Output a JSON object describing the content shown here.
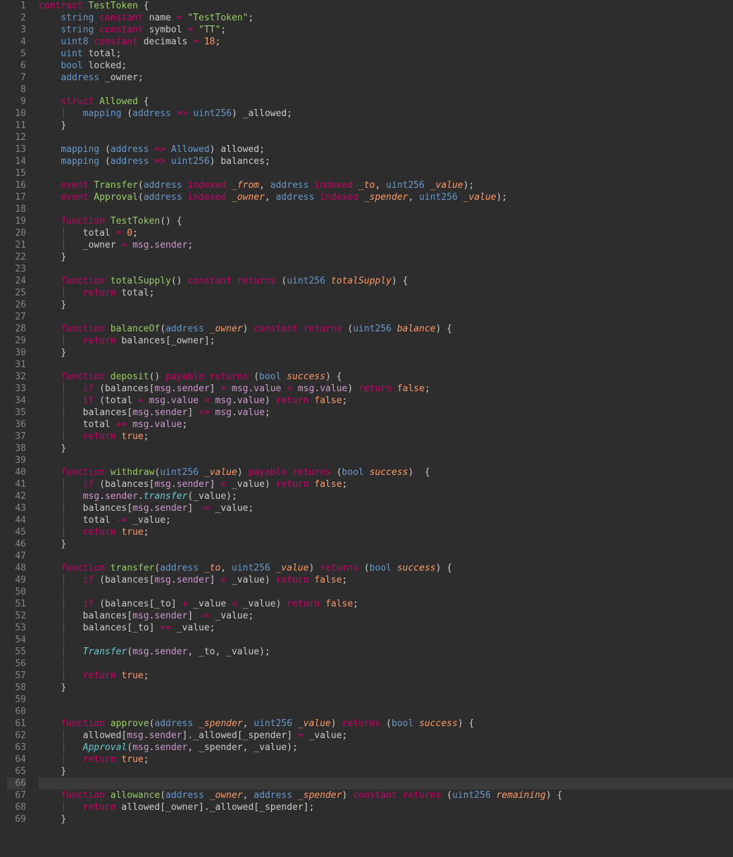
{
  "editor": {
    "active_line": 66,
    "lines": [
      {
        "n": 1,
        "html": "<span class='kw'>contract</span> <span class='fname'>TestToken</span> <span class='punct'>{</span>"
      },
      {
        "n": 2,
        "html": "    <span class='type'>string</span> <span class='mod'>constant</span> <span class='ident'>name</span> <span class='op'>=</span> <span class='str'>\"TestToken\"</span><span class='punct'>;</span>"
      },
      {
        "n": 3,
        "html": "    <span class='type'>string</span> <span class='mod'>constant</span> <span class='ident'>symbol</span> <span class='op'>=</span> <span class='str'>\"TT\"</span><span class='punct'>;</span>"
      },
      {
        "n": 4,
        "html": "    <span class='type'>uint8</span> <span class='mod'>constant</span> <span class='ident'>decimals</span> <span class='op'>=</span> <span class='num'>18</span><span class='punct'>;</span>"
      },
      {
        "n": 5,
        "html": "    <span class='type'>uint</span> <span class='ident'>total</span><span class='punct'>;</span>"
      },
      {
        "n": 6,
        "html": "    <span class='type'>bool</span> <span class='ident'>locked</span><span class='punct'>;</span>"
      },
      {
        "n": 7,
        "html": "    <span class='type'>address</span> <span class='ident'>_owner</span><span class='punct'>;</span>"
      },
      {
        "n": 8,
        "html": ""
      },
      {
        "n": 9,
        "html": "    <span class='kw'>struct</span> <span class='fname'>Allowed</span> <span class='punct'>{</span>"
      },
      {
        "n": 10,
        "html": "    <span class='guide'>│</span>   <span class='type'>mapping</span> <span class='punct'>(</span><span class='type'>address</span> <span class='op'>=&gt;</span> <span class='type'>uint256</span><span class='punct'>)</span> <span class='ident'>_allowed</span><span class='punct'>;</span>"
      },
      {
        "n": 11,
        "html": "    <span class='punct'>}</span>"
      },
      {
        "n": 12,
        "html": ""
      },
      {
        "n": 13,
        "html": "    <span class='type'>mapping</span> <span class='punct'>(</span><span class='type'>address</span> <span class='op'>=&gt;</span> <span class='type'>Allowed</span><span class='punct'>)</span> <span class='ident'>allowed</span><span class='punct'>;</span>"
      },
      {
        "n": 14,
        "html": "    <span class='type'>mapping</span> <span class='punct'>(</span><span class='type'>address</span> <span class='op'>=&gt;</span> <span class='type'>uint256</span><span class='punct'>)</span> <span class='ident'>balances</span><span class='punct'>;</span>"
      },
      {
        "n": 15,
        "html": ""
      },
      {
        "n": 16,
        "html": "    <span class='kw'>event</span> <span class='fname'>Transfer</span><span class='punct'>(</span><span class='type'>address</span> <span class='mod'>indexed</span> <span class='param'>_from</span><span class='punct'>,</span> <span class='type'>address</span> <span class='mod'>indexed</span> <span class='param'>_to</span><span class='punct'>,</span> <span class='type'>uint256</span> <span class='param'>_value</span><span class='punct'>);</span>"
      },
      {
        "n": 17,
        "html": "    <span class='kw'>event</span> <span class='fname'>Approval</span><span class='punct'>(</span><span class='type'>address</span> <span class='mod'>indexed</span> <span class='param'>_owner</span><span class='punct'>,</span> <span class='type'>address</span> <span class='mod'>indexed</span> <span class='param'>_spender</span><span class='punct'>,</span> <span class='type'>uint256</span> <span class='param'>_value</span><span class='punct'>);</span>"
      },
      {
        "n": 18,
        "html": ""
      },
      {
        "n": 19,
        "html": "    <span class='kw'>function</span> <span class='fname'>TestToken</span><span class='punct'>()</span> <span class='punct'>{</span>"
      },
      {
        "n": 20,
        "html": "    <span class='guide'>│</span>   <span class='ident'>total</span> <span class='op'>=</span> <span class='num'>0</span><span class='punct'>;</span>"
      },
      {
        "n": 21,
        "html": "    <span class='guide'>│</span>   <span class='ident'>_owner</span> <span class='op'>=</span> <span class='prop'>msg</span><span class='punct'>.</span><span class='prop'>sender</span><span class='punct'>;</span>"
      },
      {
        "n": 22,
        "html": "    <span class='punct'>}</span>"
      },
      {
        "n": 23,
        "html": ""
      },
      {
        "n": 24,
        "html": "    <span class='kw'>function</span> <span class='fname'>totalSupply</span><span class='punct'>()</span> <span class='mod'>constant</span> <span class='mod'>returns</span> <span class='punct'>(</span><span class='type'>uint256</span> <span class='param'>totalSupply</span><span class='punct'>)</span> <span class='punct'>{</span>"
      },
      {
        "n": 25,
        "html": "    <span class='guide'>│</span>   <span class='kw'>return</span> <span class='ident'>total</span><span class='punct'>;</span>"
      },
      {
        "n": 26,
        "html": "    <span class='punct'>}</span>"
      },
      {
        "n": 27,
        "html": ""
      },
      {
        "n": 28,
        "html": "    <span class='kw'>function</span> <span class='fname'>balanceOf</span><span class='punct'>(</span><span class='type'>address</span> <span class='param'>_owner</span><span class='punct'>)</span> <span class='mod'>constant</span> <span class='mod'>returns</span> <span class='punct'>(</span><span class='type'>uint256</span> <span class='param'>balance</span><span class='punct'>)</span> <span class='punct'>{</span>"
      },
      {
        "n": 29,
        "html": "    <span class='guide'>│</span>   <span class='kw'>return</span> <span class='ident'>balances</span><span class='punct'>[</span><span class='ident'>_owner</span><span class='punct'>];</span>"
      },
      {
        "n": 30,
        "html": "    <span class='punct'>}</span>"
      },
      {
        "n": 31,
        "html": ""
      },
      {
        "n": 32,
        "html": "    <span class='kw'>function</span> <span class='fname'>deposit</span><span class='punct'>()</span> <span class='mod'>payable</span> <span class='mod'>returns</span> <span class='punct'>(</span><span class='type'>bool</span> <span class='param'>success</span><span class='punct'>)</span> <span class='punct'>{</span>"
      },
      {
        "n": 33,
        "html": "    <span class='guide'>│</span>   <span class='kw'>if</span> <span class='punct'>(</span><span class='ident'>balances</span><span class='punct'>[</span><span class='prop'>msg</span><span class='punct'>.</span><span class='prop'>sender</span><span class='punct'>]</span> <span class='op'>+</span> <span class='prop'>msg</span><span class='punct'>.</span><span class='prop'>value</span> <span class='op'>&lt;</span> <span class='prop'>msg</span><span class='punct'>.</span><span class='prop'>value</span><span class='punct'>)</span> <span class='kw'>return</span> <span class='bool'>false</span><span class='punct'>;</span>"
      },
      {
        "n": 34,
        "html": "    <span class='guide'>│</span>   <span class='kw'>if</span> <span class='punct'>(</span><span class='ident'>total</span> <span class='op'>+</span> <span class='prop'>msg</span><span class='punct'>.</span><span class='prop'>value</span> <span class='op'>&lt;</span> <span class='prop'>msg</span><span class='punct'>.</span><span class='prop'>value</span><span class='punct'>)</span> <span class='kw'>return</span> <span class='bool'>false</span><span class='punct'>;</span>"
      },
      {
        "n": 35,
        "html": "    <span class='guide'>│</span>   <span class='ident'>balances</span><span class='punct'>[</span><span class='prop'>msg</span><span class='punct'>.</span><span class='prop'>sender</span><span class='punct'>]</span> <span class='op'>+=</span> <span class='prop'>msg</span><span class='punct'>.</span><span class='prop'>value</span><span class='punct'>;</span>"
      },
      {
        "n": 36,
        "html": "    <span class='guide'>│</span>   <span class='ident'>total</span> <span class='op'>+=</span> <span class='prop'>msg</span><span class='punct'>.</span><span class='prop'>value</span><span class='punct'>;</span>"
      },
      {
        "n": 37,
        "html": "    <span class='guide'>│</span>   <span class='kw'>return</span> <span class='bool'>true</span><span class='punct'>;</span>"
      },
      {
        "n": 38,
        "html": "    <span class='punct'>}</span>"
      },
      {
        "n": 39,
        "html": ""
      },
      {
        "n": 40,
        "html": "    <span class='kw'>function</span> <span class='fname'>withdraw</span><span class='punct'>(</span><span class='type'>uint256</span> <span class='param'>_value</span><span class='punct'>)</span> <span class='mod'>payable</span> <span class='mod'>returns</span> <span class='punct'>(</span><span class='type'>bool</span> <span class='param'>success</span><span class='punct'>)</span>  <span class='punct'>{</span>"
      },
      {
        "n": 41,
        "html": "    <span class='guide'>│</span>   <span class='kw'>if</span> <span class='punct'>(</span><span class='ident'>balances</span><span class='punct'>[</span><span class='prop'>msg</span><span class='punct'>.</span><span class='prop'>sender</span><span class='punct'>]</span> <span class='op'>&lt;</span> <span class='ident'>_value</span><span class='punct'>)</span> <span class='kw'>return</span> <span class='bool'>false</span><span class='punct'>;</span>"
      },
      {
        "n": 42,
        "html": "    <span class='guide'>│</span>   <span class='prop'>msg</span><span class='punct'>.</span><span class='prop'>sender</span><span class='punct'>.</span><span class='call ital'>transfer</span><span class='punct'>(</span><span class='ident'>_value</span><span class='punct'>);</span>"
      },
      {
        "n": 43,
        "html": "    <span class='guide'>│</span>   <span class='ident'>balances</span><span class='punct'>[</span><span class='prop'>msg</span><span class='punct'>.</span><span class='prop'>sender</span><span class='punct'>]</span> <span class='op'>-=</span> <span class='ident'>_value</span><span class='punct'>;</span>"
      },
      {
        "n": 44,
        "html": "    <span class='guide'>│</span>   <span class='ident'>total</span> <span class='op'>-=</span> <span class='ident'>_value</span><span class='punct'>;</span>"
      },
      {
        "n": 45,
        "html": "    <span class='guide'>│</span>   <span class='kw'>return</span> <span class='bool'>true</span><span class='punct'>;</span>"
      },
      {
        "n": 46,
        "html": "    <span class='punct'>}</span>"
      },
      {
        "n": 47,
        "html": ""
      },
      {
        "n": 48,
        "html": "    <span class='kw'>function</span> <span class='fname'>transfer</span><span class='punct'>(</span><span class='type'>address</span> <span class='param'>_to</span><span class='punct'>,</span> <span class='type'>uint256</span> <span class='param'>_value</span><span class='punct'>)</span> <span class='mod'>returns</span> <span class='punct'>(</span><span class='type'>bool</span> <span class='param'>success</span><span class='punct'>)</span> <span class='punct'>{</span>"
      },
      {
        "n": 49,
        "html": "    <span class='guide'>│</span>   <span class='kw'>if</span> <span class='punct'>(</span><span class='ident'>balances</span><span class='punct'>[</span><span class='prop'>msg</span><span class='punct'>.</span><span class='prop'>sender</span><span class='punct'>]</span> <span class='op'>&lt;</span> <span class='ident'>_value</span><span class='punct'>)</span> <span class='kw'>return</span> <span class='bool'>false</span><span class='punct'>;</span>"
      },
      {
        "n": 50,
        "html": "    <span class='guide'>│</span>"
      },
      {
        "n": 51,
        "html": "    <span class='guide'>│</span>   <span class='kw'>if</span> <span class='punct'>(</span><span class='ident'>balances</span><span class='punct'>[</span><span class='ident'>_to</span><span class='punct'>]</span> <span class='op'>+</span> <span class='ident'>_value</span> <span class='op'>&lt;</span> <span class='ident'>_value</span><span class='punct'>)</span> <span class='kw'>return</span> <span class='bool'>false</span><span class='punct'>;</span>"
      },
      {
        "n": 52,
        "html": "    <span class='guide'>│</span>   <span class='ident'>balances</span><span class='punct'>[</span><span class='prop'>msg</span><span class='punct'>.</span><span class='prop'>sender</span><span class='punct'>]</span> <span class='op'>-=</span> <span class='ident'>_value</span><span class='punct'>;</span>"
      },
      {
        "n": 53,
        "html": "    <span class='guide'>│</span>   <span class='ident'>balances</span><span class='punct'>[</span><span class='ident'>_to</span><span class='punct'>]</span> <span class='op'>+=</span> <span class='ident'>_value</span><span class='punct'>;</span>"
      },
      {
        "n": 54,
        "html": "    <span class='guide'>│</span>"
      },
      {
        "n": 55,
        "html": "    <span class='guide'>│</span>   <span class='call ital'>Transfer</span><span class='punct'>(</span><span class='prop'>msg</span><span class='punct'>.</span><span class='prop'>sender</span><span class='punct'>,</span> <span class='ident'>_to</span><span class='punct'>,</span> <span class='ident'>_value</span><span class='punct'>);</span>"
      },
      {
        "n": 56,
        "html": "    <span class='guide'>│</span>"
      },
      {
        "n": 57,
        "html": "    <span class='guide'>│</span>   <span class='kw'>return</span> <span class='bool'>true</span><span class='punct'>;</span>"
      },
      {
        "n": 58,
        "html": "    <span class='punct'>}</span>"
      },
      {
        "n": 59,
        "html": ""
      },
      {
        "n": 60,
        "html": ""
      },
      {
        "n": 61,
        "html": "    <span class='kw'>function</span> <span class='fname'>approve</span><span class='punct'>(</span><span class='type'>address</span> <span class='param'>_spender</span><span class='punct'>,</span> <span class='type'>uint256</span> <span class='param'>_value</span><span class='punct'>)</span> <span class='mod'>returns</span> <span class='punct'>(</span><span class='type'>bool</span> <span class='param'>success</span><span class='punct'>)</span> <span class='punct'>{</span>"
      },
      {
        "n": 62,
        "html": "    <span class='guide'>│</span>   <span class='ident'>allowed</span><span class='punct'>[</span><span class='prop'>msg</span><span class='punct'>.</span><span class='prop'>sender</span><span class='punct'>].</span><span class='ident'>_allowed</span><span class='punct'>[</span><span class='ident'>_spender</span><span class='punct'>]</span> <span class='op'>=</span> <span class='ident'>_value</span><span class='punct'>;</span>"
      },
      {
        "n": 63,
        "html": "    <span class='guide'>│</span>   <span class='call ital'>Approval</span><span class='punct'>(</span><span class='prop'>msg</span><span class='punct'>.</span><span class='prop'>sender</span><span class='punct'>,</span> <span class='ident'>_spender</span><span class='punct'>,</span> <span class='ident'>_value</span><span class='punct'>);</span>"
      },
      {
        "n": 64,
        "html": "    <span class='guide'>│</span>   <span class='kw'>return</span> <span class='bool'>true</span><span class='punct'>;</span>"
      },
      {
        "n": 65,
        "html": "    <span class='punct'>}</span>"
      },
      {
        "n": 66,
        "html": ""
      },
      {
        "n": 67,
        "html": "    <span class='kw'>function</span> <span class='fname'>allowance</span><span class='punct'>(</span><span class='type'>address</span> <span class='param'>_owner</span><span class='punct'>,</span> <span class='type'>address</span> <span class='param'>_spender</span><span class='punct'>)</span> <span class='mod'>constant</span> <span class='mod'>returns</span> <span class='punct'>(</span><span class='type'>uint256</span> <span class='param'>remaining</span><span class='punct'>)</span> <span class='punct'>{</span>"
      },
      {
        "n": 68,
        "html": "    <span class='guide'>│</span>   <span class='kw'>return</span> <span class='ident'>allowed</span><span class='punct'>[</span><span class='ident'>_owner</span><span class='punct'>].</span><span class='ident'>_allowed</span><span class='punct'>[</span><span class='ident'>_spender</span><span class='punct'>];</span>"
      },
      {
        "n": 69,
        "html": "    <span class='punct'>}</span>"
      }
    ]
  }
}
